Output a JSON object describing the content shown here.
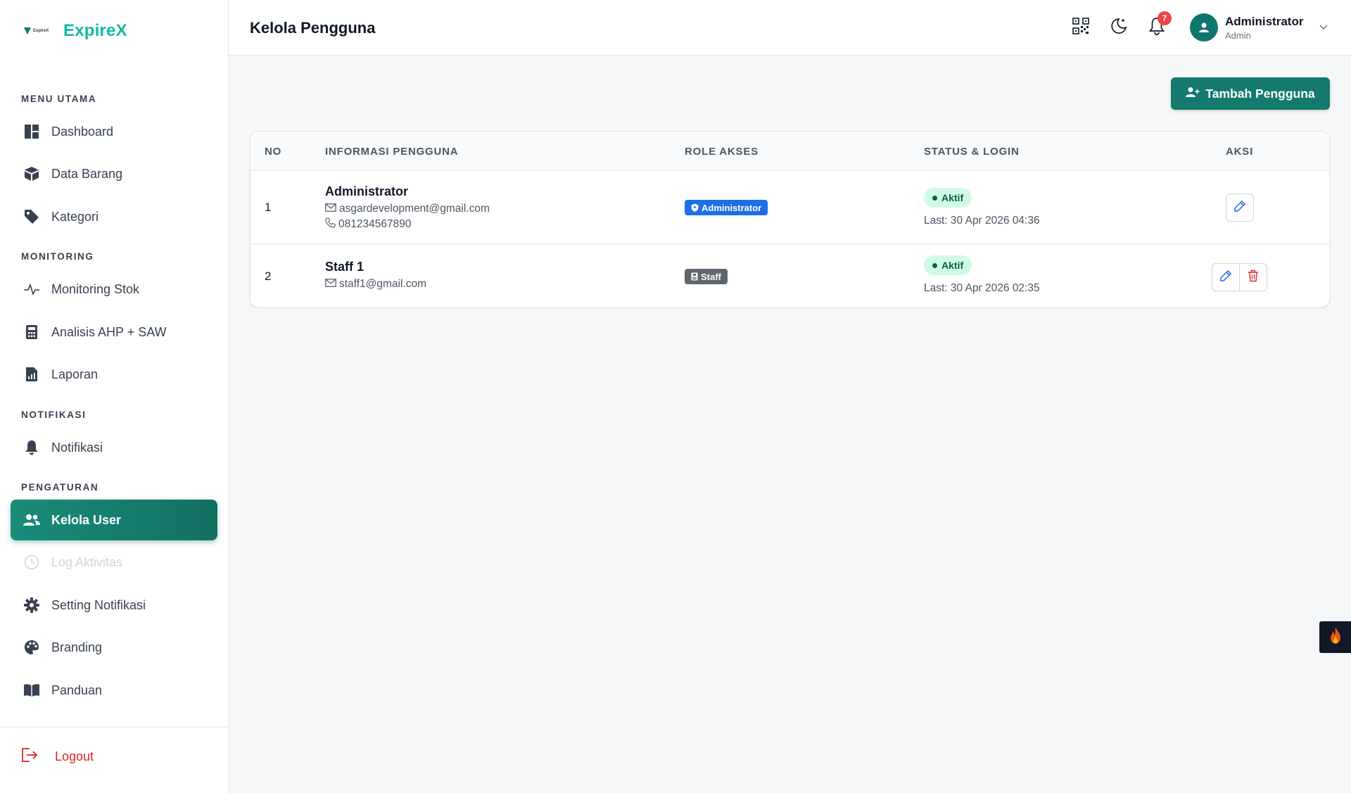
{
  "brand": {
    "name": "ExpireX",
    "logo_text": "ExpireX"
  },
  "sidebar": {
    "sections": [
      {
        "label": "MENU UTAMA"
      },
      {
        "label": "MONITORING"
      },
      {
        "label": "NOTIFIKASI"
      },
      {
        "label": "PENGATURAN"
      }
    ],
    "items": [
      {
        "label": "Dashboard",
        "icon": "dashboard-icon"
      },
      {
        "label": "Data Barang",
        "icon": "box-icon"
      },
      {
        "label": "Kategori",
        "icon": "tag-icon"
      },
      {
        "label": "Monitoring Stok",
        "icon": "pulse-icon"
      },
      {
        "label": "Analisis AHP + SAW",
        "icon": "calculator-icon"
      },
      {
        "label": "Laporan",
        "icon": "report-icon"
      },
      {
        "label": "Notifikasi",
        "icon": "bell-icon"
      },
      {
        "label": "Kelola User",
        "icon": "users-icon",
        "active": true
      },
      {
        "label": "Log Aktivitas",
        "icon": "clock-icon",
        "disabled": true
      },
      {
        "label": "Setting Notifikasi",
        "icon": "gear-icon"
      },
      {
        "label": "Branding",
        "icon": "palette-icon"
      },
      {
        "label": "Panduan",
        "icon": "book-icon"
      }
    ],
    "logout_label": "Logout"
  },
  "header": {
    "title": "Kelola Pengguna",
    "notification_count": "7",
    "user": {
      "name": "Administrator",
      "role": "Admin"
    }
  },
  "main": {
    "add_button_label": "Tambah Pengguna",
    "table": {
      "columns": [
        "NO",
        "INFORMASI PENGGUNA",
        "ROLE AKSES",
        "STATUS & LOGIN",
        "AKSI"
      ],
      "rows": [
        {
          "no": "1",
          "name": "Administrator",
          "email": "asgardevelopment@gmail.com",
          "phone": "081234567890",
          "role": "Administrator",
          "status": "Aktif",
          "last_login": "Last: 30 Apr 2026 04:36"
        },
        {
          "no": "2",
          "name": "Staff 1",
          "email": "staff1@gmail.com",
          "role": "Staff",
          "status": "Aktif",
          "last_login": "Last: 30 Apr 2026 02:35"
        }
      ]
    }
  },
  "colors": {
    "accent": "#137a6c",
    "brand": "#14b8a6",
    "danger": "#dc2626",
    "admin_badge": "#1d6fe8",
    "staff_badge": "#5f666d",
    "status_bg": "#d1fae5"
  }
}
